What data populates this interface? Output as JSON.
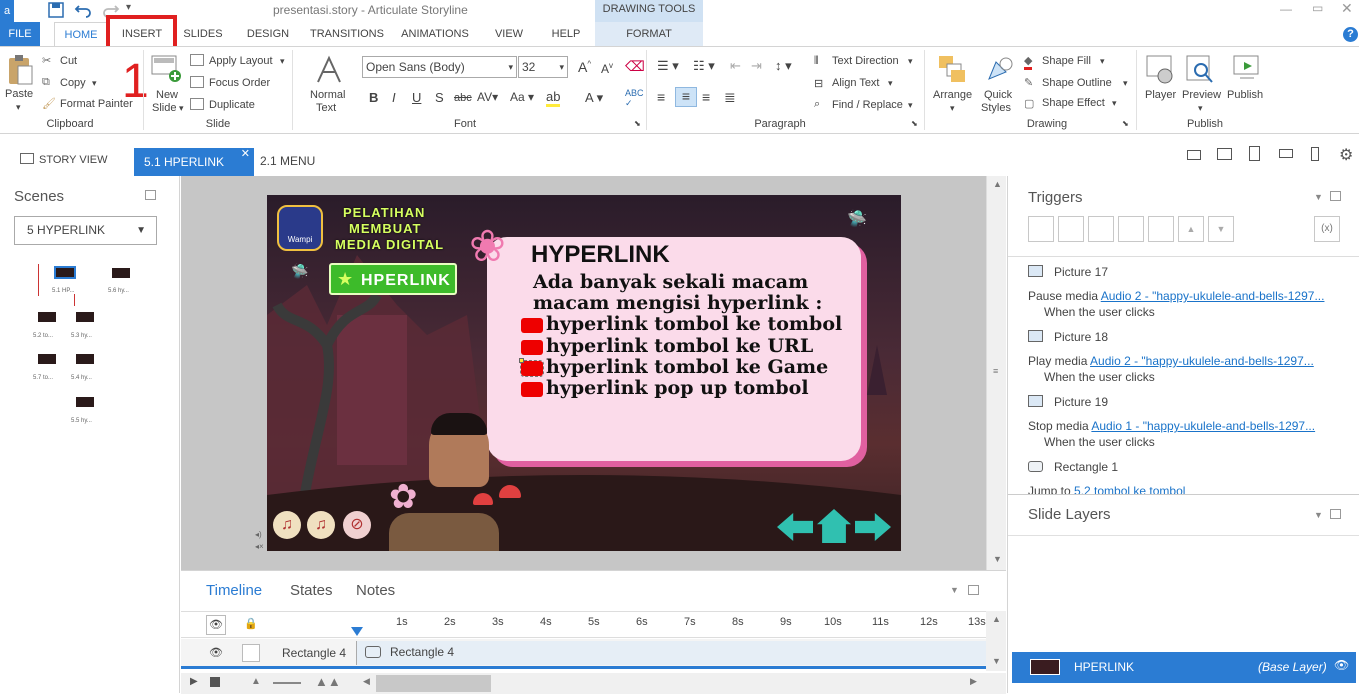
{
  "window": {
    "title": "presentasi.story - Articulate Storyline"
  },
  "contextual": {
    "label": "DRAWING TOOLS",
    "tab": "FORMAT"
  },
  "tabs": [
    "FILE",
    "HOME",
    "INSERT",
    "SLIDES",
    "DESIGN",
    "TRANSITIONS",
    "ANIMATIONS",
    "VIEW",
    "HELP"
  ],
  "annotation": {
    "number": "1"
  },
  "clipboard": {
    "paste": "Paste",
    "cut": "Cut",
    "copy": "Copy",
    "format_painter": "Format Painter",
    "group": "Clipboard"
  },
  "slide": {
    "new": "New",
    "new2": "Slide",
    "apply_layout": "Apply Layout",
    "focus_order": "Focus Order",
    "duplicate": "Duplicate",
    "group": "Slide"
  },
  "font": {
    "normal": "Normal",
    "text": "Text",
    "family": "Open Sans (Body)",
    "size": "32",
    "group": "Font"
  },
  "paragraph": {
    "text_direction": "Text Direction",
    "align_text": "Align Text",
    "find_replace": "Find / Replace",
    "group": "Paragraph"
  },
  "drawing": {
    "arrange": "Arrange",
    "quick": "Quick",
    "styles": "Styles",
    "shape_fill": "Shape Fill",
    "shape_outline": "Shape Outline",
    "shape_effect": "Shape Effect",
    "group": "Drawing"
  },
  "publish": {
    "player": "Player",
    "preview": "Preview",
    "publish": "Publish",
    "group": "Publish"
  },
  "doctabs": {
    "story_view": "STORY VIEW",
    "active": "5.1 HPERLINK",
    "other": "2.1 MENU"
  },
  "scenes": {
    "title": "Scenes",
    "selected": "5 HYPERLINK",
    "thumbs": [
      "5.1 HP...",
      "5.6 hy...",
      "5.2 to...",
      "5.3 hy...",
      "5.7 to...",
      "5.4 hy...",
      "5.5 hy..."
    ]
  },
  "slide_content": {
    "badge_line1": "PELATIHAN",
    "badge_line2": "MEMBUAT",
    "badge_line3": "MEDIA DIGITAL",
    "logo": "Wampi",
    "green_button": "HPERLINK",
    "heading": "HYPERLINK",
    "intro1": "Ada banyak sekali macam",
    "intro2": "macam mengisi hyperlink :",
    "items": [
      "hyperlink tombol ke tombol",
      "hyperlink tombol ke URL",
      "hyperlink tombol ke Game",
      "hyperlink pop up tombol"
    ]
  },
  "timeline": {
    "tabs": [
      "Timeline",
      "States",
      "Notes"
    ],
    "ticks": [
      "1s",
      "2s",
      "3s",
      "4s",
      "5s",
      "6s",
      "7s",
      "8s",
      "9s",
      "10s",
      "11s",
      "12s",
      "13s"
    ],
    "row_label": "Rectangle 4",
    "bar_label": "Rectangle 4"
  },
  "triggers": {
    "title": "Triggers",
    "items": [
      {
        "object": "Picture 17",
        "action": "Pause media",
        "target": "Audio 2 - \"happy-ukulele-and-bells-1297...",
        "when": "When the user clicks"
      },
      {
        "object": "Picture 18",
        "action": "Play media",
        "target": "Audio 2 - \"happy-ukulele-and-bells-1297...",
        "when": "When the user clicks"
      },
      {
        "object": "Picture 19",
        "action": "Stop media",
        "target": "Audio 1 - \"happy-ukulele-and-bells-1297...",
        "when": "When the user clicks"
      },
      {
        "object": "Rectangle 1",
        "action": "Jump to",
        "target": "5.2 tombol ke tombol",
        "when": ""
      }
    ]
  },
  "layers": {
    "title": "Slide Layers",
    "name": "HPERLINK",
    "base": "(Base Layer)"
  },
  "colors": {
    "accent": "#2b7cd3",
    "highlight": "#e02020",
    "contextual_bg": "#cfe1f3"
  }
}
